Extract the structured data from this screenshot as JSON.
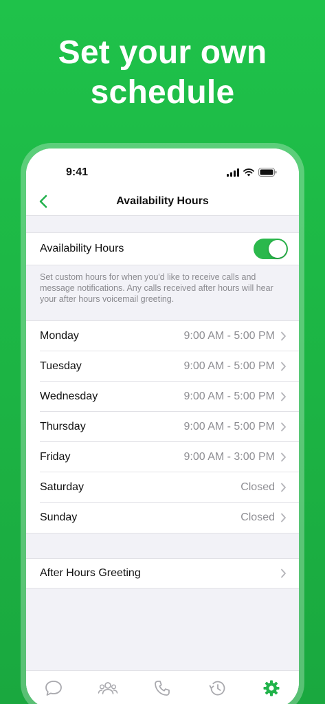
{
  "headline": {
    "line1": "Set your own",
    "line2": "schedule"
  },
  "status": {
    "time": "9:41"
  },
  "nav": {
    "title": "Availability Hours"
  },
  "availability": {
    "label": "Availability Hours",
    "enabled": true,
    "note": "Set custom hours for when you'd like to receive calls and message notifications. Any calls received after hours will hear your after hours voicemail greeting."
  },
  "days": [
    {
      "name": "Monday",
      "hours": "9:00 AM - 5:00 PM"
    },
    {
      "name": "Tuesday",
      "hours": "9:00 AM - 5:00 PM"
    },
    {
      "name": "Wednesday",
      "hours": "9:00 AM - 5:00 PM"
    },
    {
      "name": "Thursday",
      "hours": "9:00 AM - 5:00 PM"
    },
    {
      "name": "Friday",
      "hours": "9:00 AM - 3:00 PM"
    },
    {
      "name": "Saturday",
      "hours": "Closed"
    },
    {
      "name": "Sunday",
      "hours": "Closed"
    }
  ],
  "greeting": {
    "label": "After Hours Greeting"
  },
  "tabs": [
    {
      "icon": "chat-bubble-icon"
    },
    {
      "icon": "contacts-icon"
    },
    {
      "icon": "phone-icon"
    },
    {
      "icon": "history-icon"
    },
    {
      "icon": "settings-gear-icon",
      "active": true
    }
  ],
  "colors": {
    "brand": "#1fc24a",
    "toggle": "#2bb84c",
    "active_tab": "#21b34a",
    "inactive_tab": "#a9a9ae"
  }
}
